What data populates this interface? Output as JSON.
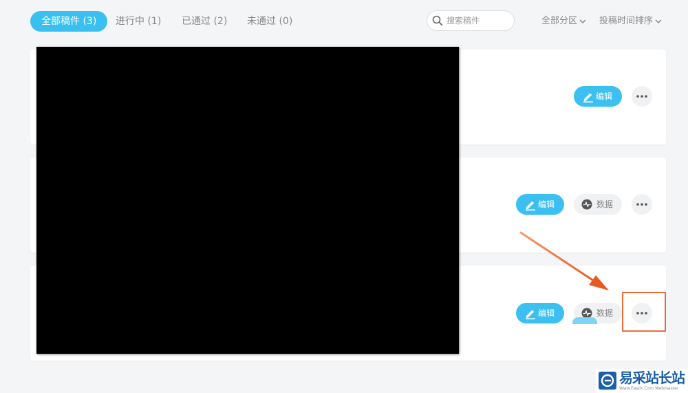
{
  "tabs": [
    {
      "label": "全部稿件 (3)",
      "active": true
    },
    {
      "label": "进行中 (1)",
      "active": false
    },
    {
      "label": "已通过 (2)",
      "active": false
    },
    {
      "label": "未通过 (0)",
      "active": false
    }
  ],
  "search": {
    "placeholder": "搜索稿件",
    "icon": "search-icon"
  },
  "filters": {
    "partition_label": "全部分区",
    "sort_label": "投稿时间排序"
  },
  "cards": [
    {
      "edit_label": "编辑",
      "has_data": false,
      "more_icon": "more-dots-icon"
    },
    {
      "edit_label": "编辑",
      "data_label": "数据",
      "has_data": true,
      "more_icon": "more-dots-icon"
    },
    {
      "edit_label": "编辑",
      "data_label": "数据",
      "has_data": true,
      "more_icon": "more-dots-icon",
      "highlighted": true
    }
  ],
  "annotation": {
    "arrow_color": "#f06a36",
    "box_color": "#f06a36"
  },
  "colors": {
    "accent": "#39c0f0",
    "background": "#f4f5f7",
    "card": "#ffffff",
    "pill_gray": "#f0f1f3"
  },
  "watermark": {
    "title": "易采站长站",
    "subtitle": "Www.Easck.Com  Webmaster"
  }
}
